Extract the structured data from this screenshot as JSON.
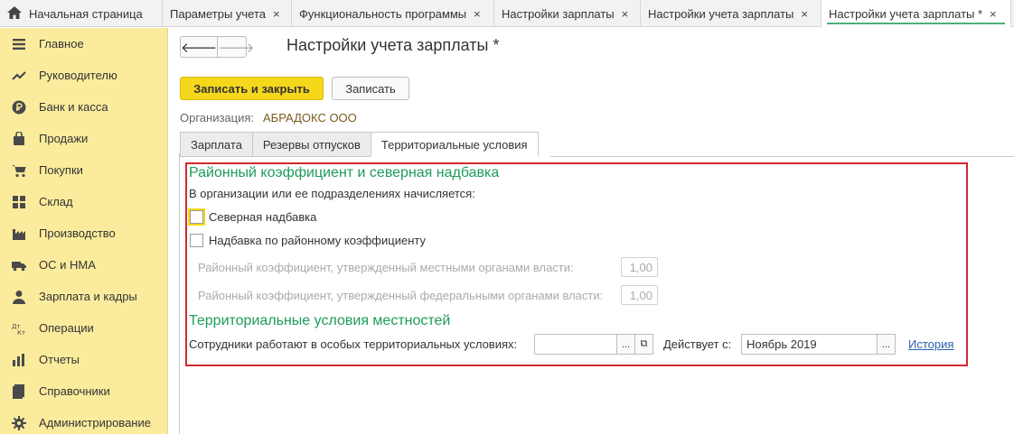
{
  "tabbar": {
    "home_label": "Начальная страница",
    "tabs": [
      {
        "label": "Параметры учета",
        "close": "×"
      },
      {
        "label": "Функциональность программы",
        "close": "×"
      },
      {
        "label": "Настройки зарплаты",
        "close": "×"
      },
      {
        "label": "Настройки учета зарплаты",
        "close": "×"
      },
      {
        "label": "Настройки учета зарплаты *",
        "close": "×"
      }
    ]
  },
  "sidebar": {
    "items": [
      {
        "label": "Главное",
        "icon": "menu-icon"
      },
      {
        "label": "Руководителю",
        "icon": "trend-icon"
      },
      {
        "label": "Банк и касса",
        "icon": "ruble-icon"
      },
      {
        "label": "Продажи",
        "icon": "bag-icon"
      },
      {
        "label": "Покупки",
        "icon": "cart-icon"
      },
      {
        "label": "Склад",
        "icon": "warehouse-icon"
      },
      {
        "label": "Производство",
        "icon": "factory-icon"
      },
      {
        "label": "ОС и НМА",
        "icon": "truck-icon"
      },
      {
        "label": "Зарплата и кадры",
        "icon": "person-icon"
      },
      {
        "label": "Операции",
        "icon": "dt-kt-icon"
      },
      {
        "label": "Отчеты",
        "icon": "bar-chart-icon"
      },
      {
        "label": "Справочники",
        "icon": "book-icon"
      },
      {
        "label": "Администрирование",
        "icon": "gear-icon"
      }
    ]
  },
  "nav": {
    "back": "🡐",
    "forward": "🡒"
  },
  "page": {
    "title": "Настройки учета зарплаты *",
    "save_close": "Записать и закрыть",
    "save": "Записать",
    "org_label": "Организация:",
    "org_value": "АБРАДОКС ООО"
  },
  "form_tabs": [
    "Зарплата",
    "Резервы отпусков",
    "Территориальные условия"
  ],
  "section1": {
    "title": "Районный коэффициент и северная надбавка",
    "subtitle": "В организации или ее подразделениях начисляется:",
    "north_bonus": "Северная надбавка",
    "regional_bonus": "Надбавка по районному коэффициенту",
    "local_coef_label": "Районный коэффициент, утвержденный местными органами власти:",
    "local_coef_value": "1,00",
    "federal_coef_label": "Районный коэффициент, утвержденный федеральными органами власти:",
    "federal_coef_value": "1,00"
  },
  "section2": {
    "title": "Территориальные условия местностей",
    "employees_label": "Сотрудники работают в особых территориальных условиях:",
    "employees_value": "",
    "select_btn": "...",
    "open_btn": "⧉",
    "valid_from_label": "Действует с:",
    "valid_from_value": "Ноябрь 2019",
    "history_link": "История"
  }
}
